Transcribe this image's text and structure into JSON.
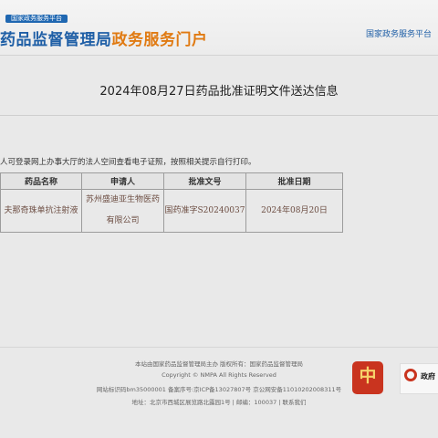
{
  "header": {
    "tagline": "国家政务服务平台",
    "logo_main": "药品监督管理局",
    "logo_sub": "政务服务门户",
    "gov_link": "国家政务服务平台"
  },
  "document": {
    "title": "2024年08月27日药品批准证明文件送达信息",
    "notice": "人可登录网上办事大厅的法人空间查看电子证照，按照相关提示自行打印。"
  },
  "table": {
    "headers": [
      "药品名称",
      "申请人",
      "批准文号",
      "批准日期"
    ],
    "rows": [
      [
        "夫那奇珠单抗注射液",
        "苏州盛迪亚生物医药有限公司",
        "国药准字S20240037",
        "2024年08月20日"
      ]
    ]
  },
  "footer": {
    "line1": "本站由国家药品监督管理局主办 版权所有：国家药品监督管理局",
    "line2": "Copyright © NMPA All Rights Reserved",
    "line3": "网站标识码bm35000001   备案序号:京ICP备13027807号   京公网安备11010202008311号",
    "line4": "地址：北京市西城区展览路北露园1号 | 邮编：100037 | 联系我们"
  },
  "badges": {
    "badge1_glyph": "中",
    "badge2_text": "政府"
  }
}
